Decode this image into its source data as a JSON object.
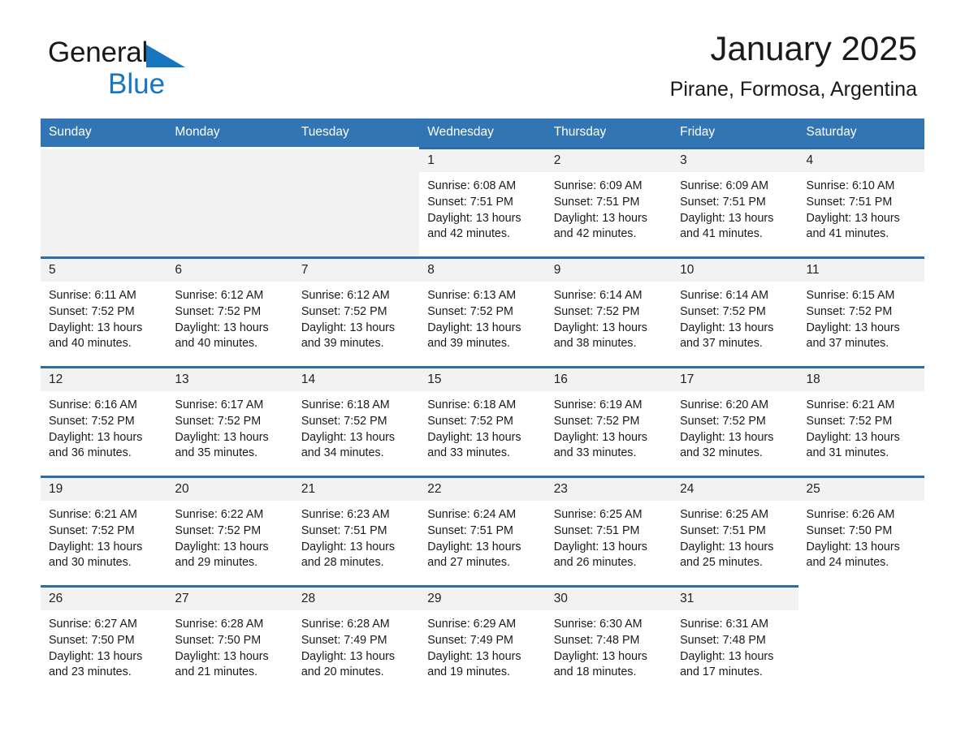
{
  "brand": {
    "name_part1": "General",
    "name_part2": "Blue",
    "triangle_icon": "brand-triangle-icon",
    "accent_color": "#1676c0"
  },
  "header": {
    "title": "January 2025",
    "subtitle": "Pirane, Formosa, Argentina"
  },
  "theme": {
    "header_blue": "#3275b5",
    "row_rule_blue": "#2e6da4",
    "daynum_band": "#f2f2f2"
  },
  "calendar": {
    "weekday_headers": [
      "Sunday",
      "Monday",
      "Tuesday",
      "Wednesday",
      "Thursday",
      "Friday",
      "Saturday"
    ],
    "weeks": [
      [
        {
          "day": "",
          "sunrise": "",
          "sunset": "",
          "daylight": ""
        },
        {
          "day": "",
          "sunrise": "",
          "sunset": "",
          "daylight": ""
        },
        {
          "day": "",
          "sunrise": "",
          "sunset": "",
          "daylight": ""
        },
        {
          "day": "1",
          "sunrise": "Sunrise: 6:08 AM",
          "sunset": "Sunset: 7:51 PM",
          "daylight": "Daylight: 13 hours and 42 minutes."
        },
        {
          "day": "2",
          "sunrise": "Sunrise: 6:09 AM",
          "sunset": "Sunset: 7:51 PM",
          "daylight": "Daylight: 13 hours and 42 minutes."
        },
        {
          "day": "3",
          "sunrise": "Sunrise: 6:09 AM",
          "sunset": "Sunset: 7:51 PM",
          "daylight": "Daylight: 13 hours and 41 minutes."
        },
        {
          "day": "4",
          "sunrise": "Sunrise: 6:10 AM",
          "sunset": "Sunset: 7:51 PM",
          "daylight": "Daylight: 13 hours and 41 minutes."
        }
      ],
      [
        {
          "day": "5",
          "sunrise": "Sunrise: 6:11 AM",
          "sunset": "Sunset: 7:52 PM",
          "daylight": "Daylight: 13 hours and 40 minutes."
        },
        {
          "day": "6",
          "sunrise": "Sunrise: 6:12 AM",
          "sunset": "Sunset: 7:52 PM",
          "daylight": "Daylight: 13 hours and 40 minutes."
        },
        {
          "day": "7",
          "sunrise": "Sunrise: 6:12 AM",
          "sunset": "Sunset: 7:52 PM",
          "daylight": "Daylight: 13 hours and 39 minutes."
        },
        {
          "day": "8",
          "sunrise": "Sunrise: 6:13 AM",
          "sunset": "Sunset: 7:52 PM",
          "daylight": "Daylight: 13 hours and 39 minutes."
        },
        {
          "day": "9",
          "sunrise": "Sunrise: 6:14 AM",
          "sunset": "Sunset: 7:52 PM",
          "daylight": "Daylight: 13 hours and 38 minutes."
        },
        {
          "day": "10",
          "sunrise": "Sunrise: 6:14 AM",
          "sunset": "Sunset: 7:52 PM",
          "daylight": "Daylight: 13 hours and 37 minutes."
        },
        {
          "day": "11",
          "sunrise": "Sunrise: 6:15 AM",
          "sunset": "Sunset: 7:52 PM",
          "daylight": "Daylight: 13 hours and 37 minutes."
        }
      ],
      [
        {
          "day": "12",
          "sunrise": "Sunrise: 6:16 AM",
          "sunset": "Sunset: 7:52 PM",
          "daylight": "Daylight: 13 hours and 36 minutes."
        },
        {
          "day": "13",
          "sunrise": "Sunrise: 6:17 AM",
          "sunset": "Sunset: 7:52 PM",
          "daylight": "Daylight: 13 hours and 35 minutes."
        },
        {
          "day": "14",
          "sunrise": "Sunrise: 6:18 AM",
          "sunset": "Sunset: 7:52 PM",
          "daylight": "Daylight: 13 hours and 34 minutes."
        },
        {
          "day": "15",
          "sunrise": "Sunrise: 6:18 AM",
          "sunset": "Sunset: 7:52 PM",
          "daylight": "Daylight: 13 hours and 33 minutes."
        },
        {
          "day": "16",
          "sunrise": "Sunrise: 6:19 AM",
          "sunset": "Sunset: 7:52 PM",
          "daylight": "Daylight: 13 hours and 33 minutes."
        },
        {
          "day": "17",
          "sunrise": "Sunrise: 6:20 AM",
          "sunset": "Sunset: 7:52 PM",
          "daylight": "Daylight: 13 hours and 32 minutes."
        },
        {
          "day": "18",
          "sunrise": "Sunrise: 6:21 AM",
          "sunset": "Sunset: 7:52 PM",
          "daylight": "Daylight: 13 hours and 31 minutes."
        }
      ],
      [
        {
          "day": "19",
          "sunrise": "Sunrise: 6:21 AM",
          "sunset": "Sunset: 7:52 PM",
          "daylight": "Daylight: 13 hours and 30 minutes."
        },
        {
          "day": "20",
          "sunrise": "Sunrise: 6:22 AM",
          "sunset": "Sunset: 7:52 PM",
          "daylight": "Daylight: 13 hours and 29 minutes."
        },
        {
          "day": "21",
          "sunrise": "Sunrise: 6:23 AM",
          "sunset": "Sunset: 7:51 PM",
          "daylight": "Daylight: 13 hours and 28 minutes."
        },
        {
          "day": "22",
          "sunrise": "Sunrise: 6:24 AM",
          "sunset": "Sunset: 7:51 PM",
          "daylight": "Daylight: 13 hours and 27 minutes."
        },
        {
          "day": "23",
          "sunrise": "Sunrise: 6:25 AM",
          "sunset": "Sunset: 7:51 PM",
          "daylight": "Daylight: 13 hours and 26 minutes."
        },
        {
          "day": "24",
          "sunrise": "Sunrise: 6:25 AM",
          "sunset": "Sunset: 7:51 PM",
          "daylight": "Daylight: 13 hours and 25 minutes."
        },
        {
          "day": "25",
          "sunrise": "Sunrise: 6:26 AM",
          "sunset": "Sunset: 7:50 PM",
          "daylight": "Daylight: 13 hours and 24 minutes."
        }
      ],
      [
        {
          "day": "26",
          "sunrise": "Sunrise: 6:27 AM",
          "sunset": "Sunset: 7:50 PM",
          "daylight": "Daylight: 13 hours and 23 minutes."
        },
        {
          "day": "27",
          "sunrise": "Sunrise: 6:28 AM",
          "sunset": "Sunset: 7:50 PM",
          "daylight": "Daylight: 13 hours and 21 minutes."
        },
        {
          "day": "28",
          "sunrise": "Sunrise: 6:28 AM",
          "sunset": "Sunset: 7:49 PM",
          "daylight": "Daylight: 13 hours and 20 minutes."
        },
        {
          "day": "29",
          "sunrise": "Sunrise: 6:29 AM",
          "sunset": "Sunset: 7:49 PM",
          "daylight": "Daylight: 13 hours and 19 minutes."
        },
        {
          "day": "30",
          "sunrise": "Sunrise: 6:30 AM",
          "sunset": "Sunset: 7:48 PM",
          "daylight": "Daylight: 13 hours and 18 minutes."
        },
        {
          "day": "31",
          "sunrise": "Sunrise: 6:31 AM",
          "sunset": "Sunset: 7:48 PM",
          "daylight": "Daylight: 13 hours and 17 minutes."
        },
        {
          "day": "",
          "sunrise": "",
          "sunset": "",
          "daylight": ""
        }
      ]
    ]
  }
}
